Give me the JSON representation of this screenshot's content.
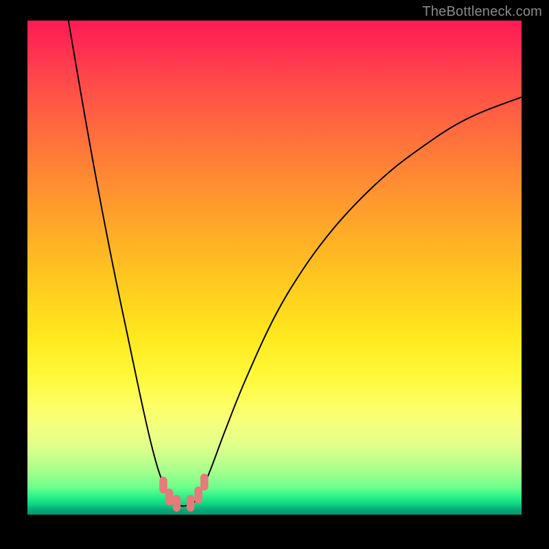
{
  "watermark": "TheBottleneck.com",
  "colors": {
    "page_bg": "#000000",
    "gradient_top": "#ff1a55",
    "gradient_bottom": "#04946f",
    "curve_stroke": "#000000",
    "marker_fill": "#e77a7a"
  },
  "chart_data": {
    "type": "line",
    "title": "",
    "xlabel": "",
    "ylabel": "",
    "xlim": [
      0,
      100
    ],
    "ylim": [
      0,
      100
    ],
    "grid": false,
    "series": [
      {
        "name": "left-branch",
        "x": [
          8.3,
          10,
          12,
          14,
          16,
          18,
          20,
          22,
          23.5,
          25,
          26.5,
          28,
          29,
          30
        ],
        "y": [
          100,
          90,
          78.5,
          67.5,
          57,
          47,
          37.5,
          28,
          21,
          14.5,
          9,
          5,
          3,
          2.2
        ]
      },
      {
        "name": "right-branch",
        "x": [
          33.5,
          35,
          37,
          40,
          44,
          50,
          56,
          62,
          68,
          74,
          80,
          86,
          92,
          100
        ],
        "y": [
          2.2,
          4.5,
          9,
          17,
          27,
          40,
          50,
          58,
          64.5,
          70,
          74.5,
          78.5,
          81.5,
          84.5
        ]
      },
      {
        "name": "valley",
        "x": [
          30,
          31,
          32,
          33.5
        ],
        "y": [
          2.2,
          1.8,
          1.8,
          2.2
        ]
      }
    ],
    "markers": [
      {
        "x": 27.5,
        "y": 6.0
      },
      {
        "x": 28.7,
        "y": 3.6
      },
      {
        "x": 30.2,
        "y": 2.3
      },
      {
        "x": 33.0,
        "y": 2.3
      },
      {
        "x": 34.6,
        "y": 4.0
      },
      {
        "x": 35.8,
        "y": 6.6
      }
    ],
    "marker_style": {
      "shape": "rounded-rect",
      "width_pct": 1.6,
      "height_pct": 3.4,
      "rx_pct": 0.8
    }
  }
}
